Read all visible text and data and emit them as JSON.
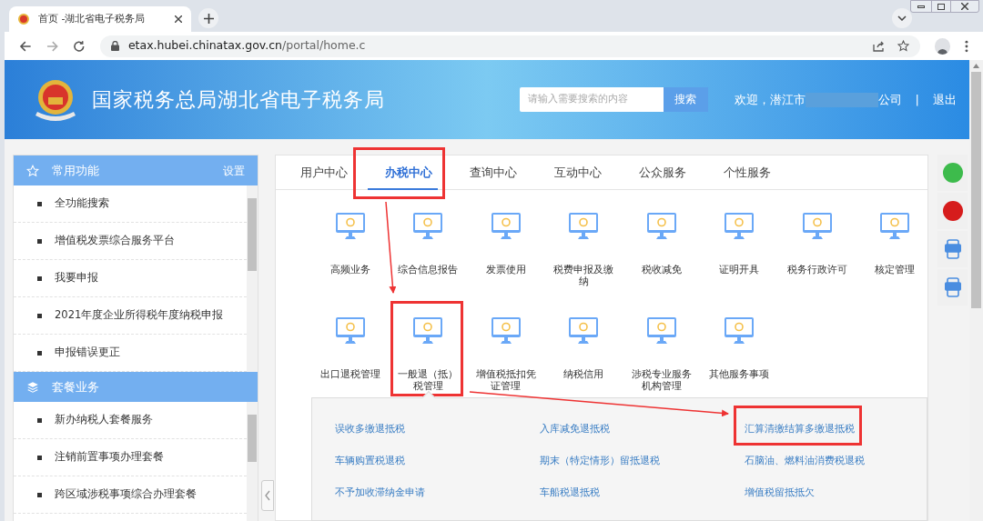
{
  "browser": {
    "tab_title": "首页 -湖北省电子税务局",
    "url_host": "etax.hubei.chinatax.gov.cn",
    "url_path": "/portal/home.c"
  },
  "header": {
    "title": "国家税务总局湖北省电子税务局",
    "search": {
      "placeholder": "请输入需要搜索的内容"
    },
    "search_button": "搜索",
    "welcome": "欢迎，潜江市",
    "company_suffix": "公司",
    "separator": "|",
    "logout": "退出"
  },
  "sidebar": [
    {
      "kind": "favorites",
      "title": "常用功能",
      "action": "设置",
      "items": [
        "全功能搜索",
        "增值税发票综合服务平台",
        "我要申报",
        "2021年度企业所得税年度纳税申报",
        "申报错误更正"
      ]
    },
    {
      "kind": "packages",
      "title": "套餐业务",
      "items": [
        "新办纳税人套餐服务",
        "注销前置事项办理套餐",
        "跨区域涉税事项综合办理套餐"
      ]
    }
  ],
  "tabs": [
    {
      "label": "用户中心",
      "selected": false,
      "annotated": false
    },
    {
      "label": "办税中心",
      "selected": true,
      "annotated": true
    },
    {
      "label": "查询中心",
      "selected": false,
      "annotated": false
    },
    {
      "label": "互动中心",
      "selected": false,
      "annotated": false
    },
    {
      "label": "公众服务",
      "selected": false,
      "annotated": false
    },
    {
      "label": "个性服务",
      "selected": false,
      "annotated": false
    }
  ],
  "tiles": [
    {
      "label": "高频业务",
      "annotated": false
    },
    {
      "label": "综合信息报告",
      "annotated": false
    },
    {
      "label": "发票使用",
      "annotated": false
    },
    {
      "label": "税费申报及缴纳",
      "annotated": false
    },
    {
      "label": "税收减免",
      "annotated": false
    },
    {
      "label": "证明开具",
      "annotated": false
    },
    {
      "label": "税务行政许可",
      "annotated": false
    },
    {
      "label": "核定管理",
      "annotated": false
    },
    {
      "label": "出口退税管理",
      "annotated": false
    },
    {
      "label": "一般退（抵）税管理",
      "annotated": true
    },
    {
      "label": "增值税抵扣凭证管理",
      "annotated": false
    },
    {
      "label": "纳税信用",
      "annotated": false
    },
    {
      "label": "涉税专业服务机构管理",
      "annotated": false
    },
    {
      "label": "其他服务事项",
      "annotated": false
    }
  ],
  "submenu": [
    {
      "label": "误收多缴退抵税",
      "annotated": false
    },
    {
      "label": "入库减免退抵税",
      "annotated": false
    },
    {
      "label": "汇算清缴结算多缴退抵税",
      "annotated": true
    },
    {
      "label": "车辆购置税退税",
      "annotated": false
    },
    {
      "label": "期末（特定情形）留抵退税",
      "annotated": false
    },
    {
      "label": "石脑油、燃料油消费税退税",
      "annotated": false
    },
    {
      "label": "不予加收滞纳金申请",
      "annotated": false
    },
    {
      "label": "车船税退抵税",
      "annotated": false
    },
    {
      "label": "增值税留抵抵欠",
      "annotated": false
    }
  ]
}
